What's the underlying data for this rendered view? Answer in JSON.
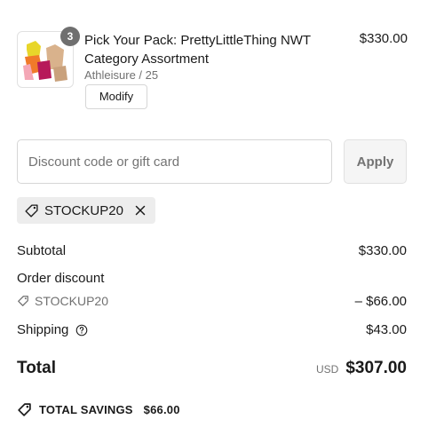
{
  "line_item": {
    "quantity": "3",
    "title": "Pick Your Pack: PrettyLittleThing NWT Category Assortment",
    "variant": "Athleisure / 25",
    "modify_label": "Modify",
    "price": "$330.00"
  },
  "discount": {
    "placeholder": "Discount code or gift card",
    "apply_label": "Apply",
    "applied_code": "STOCKUP20"
  },
  "summary": {
    "subtotal_label": "Subtotal",
    "subtotal_value": "$330.00",
    "order_discount_label": "Order discount",
    "discount_code": "STOCKUP20",
    "discount_value": "– $66.00",
    "shipping_label": "Shipping",
    "shipping_value": "$43.00",
    "total_label": "Total",
    "total_currency": "USD",
    "total_value": "$307.00",
    "savings_label": "TOTAL SAVINGS",
    "savings_value": "$66.00"
  },
  "icons": {
    "tag": "tag-icon",
    "close": "close-icon",
    "help": "question-circle-icon"
  },
  "colors": {
    "text": "#1a1a1a",
    "muted": "#717171",
    "border": "#d6d6d6",
    "badge": "#6f6f6f",
    "tag_bg": "#ededed"
  }
}
